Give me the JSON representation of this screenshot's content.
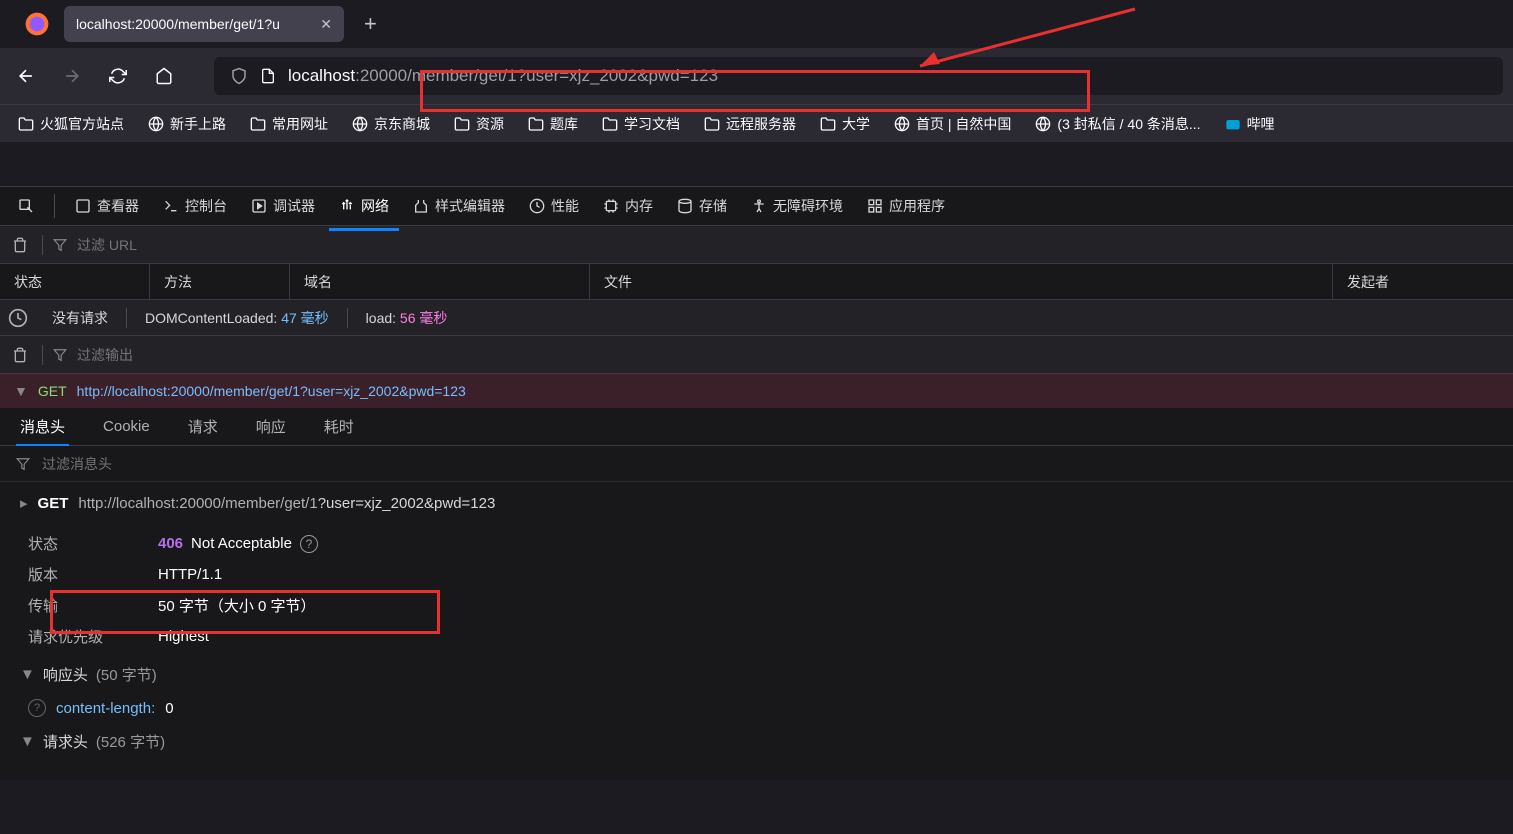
{
  "tab": {
    "title": "localhost:20000/member/get/1?u"
  },
  "url": {
    "host": "localhost",
    "path": ":20000/member/get/1?user=xjz_2002&pwd=123"
  },
  "bookmarks": [
    {
      "icon": "folder",
      "label": "火狐官方站点"
    },
    {
      "icon": "globe",
      "label": "新手上路"
    },
    {
      "icon": "folder",
      "label": "常用网址"
    },
    {
      "icon": "globe",
      "label": "京东商城"
    },
    {
      "icon": "folder",
      "label": "资源"
    },
    {
      "icon": "folder",
      "label": "题库"
    },
    {
      "icon": "folder",
      "label": "学习文档"
    },
    {
      "icon": "folder",
      "label": "远程服务器"
    },
    {
      "icon": "folder",
      "label": "大学"
    },
    {
      "icon": "globe",
      "label": "首页 | 自然中国"
    },
    {
      "icon": "globe",
      "label": "(3 封私信 / 40 条消息..."
    },
    {
      "icon": "tv",
      "label": "哔哩"
    }
  ],
  "devtools": {
    "tabs": {
      "inspector": "查看器",
      "console": "控制台",
      "debugger": "调试器",
      "network": "网络",
      "style": "样式编辑器",
      "perf": "性能",
      "memory": "内存",
      "storage": "存储",
      "a11y": "无障碍环境",
      "app": "应用程序"
    },
    "filter_url_placeholder": "过滤 URL",
    "columns": {
      "status": "状态",
      "method": "方法",
      "domain": "域名",
      "file": "文件",
      "initiator": "发起者"
    },
    "timing": {
      "no_req": "没有请求",
      "dcl_label": "DOMContentLoaded:",
      "dcl_val": "47 毫秒",
      "load_label": "load:",
      "load_val": "56 毫秒"
    },
    "filter_output_placeholder": "过滤输出",
    "request": {
      "method": "GET",
      "url": "http://localhost:20000/member/get/1?user=xjz_2002&pwd=123"
    },
    "detail_tabs": {
      "headers": "消息头",
      "cookie": "Cookie",
      "request": "请求",
      "response": "响应",
      "timing": "耗时"
    },
    "filter_headers_placeholder": "过滤消息头",
    "summary": {
      "method": "GET",
      "u1": "http://localhost:20000/member/get/1",
      "u2": "?user=xjz_2002&pwd=123"
    },
    "rows": {
      "status_label": "状态",
      "status_code": "406",
      "status_text": "Not Acceptable",
      "version_label": "版本",
      "version_val": "HTTP/1.1",
      "transfer_label": "传输",
      "transfer_val": "50 字节（大小 0 字节）",
      "priority_label": "请求优先级",
      "priority_val": "Highest"
    },
    "response_headers": {
      "title": "响应头",
      "count": "(50 字节)",
      "items": [
        {
          "name": "content-length:",
          "value": "0"
        }
      ]
    },
    "request_headers": {
      "title": "请求头",
      "count": "(526 字节)"
    }
  }
}
